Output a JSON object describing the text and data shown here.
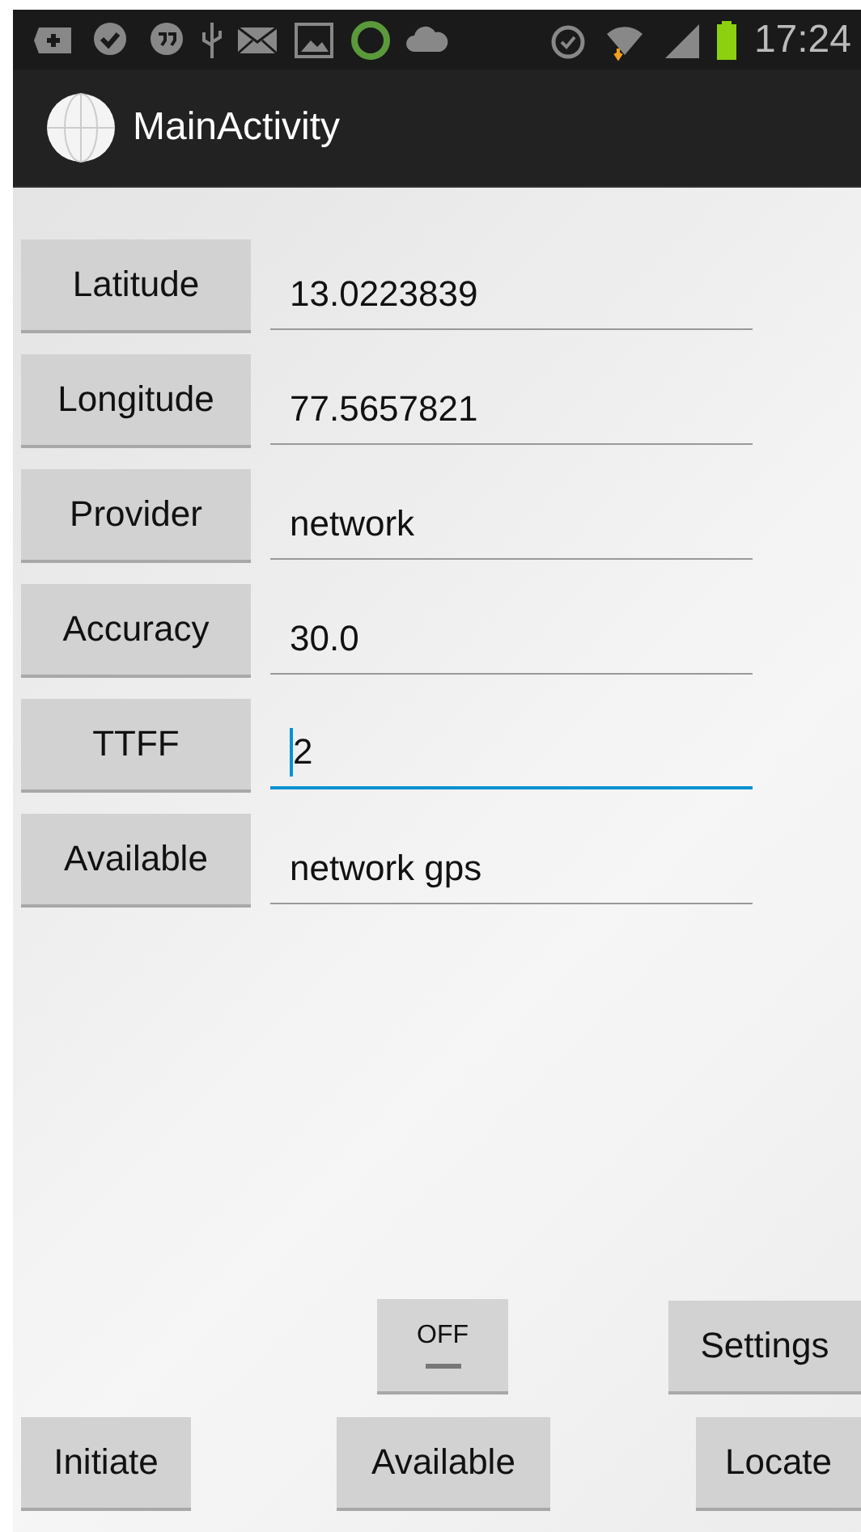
{
  "status_bar": {
    "time": "17:24"
  },
  "action_bar": {
    "title": "MainActivity"
  },
  "rows": [
    {
      "button": "Latitude",
      "value": "13.0223839",
      "focused": false
    },
    {
      "button": "Longitude",
      "value": "77.5657821",
      "focused": false
    },
    {
      "button": "Provider",
      "value": "network",
      "focused": false
    },
    {
      "button": "Accuracy",
      "value": "30.0",
      "focused": false
    },
    {
      "button": "TTFF",
      "value": "2",
      "focused": true
    },
    {
      "button": "Available",
      "value": "network gps",
      "focused": false
    }
  ],
  "toggle": {
    "label": "OFF",
    "on": false
  },
  "buttons": [
    "Settings",
    "Initiate",
    "Available",
    "Locate"
  ]
}
